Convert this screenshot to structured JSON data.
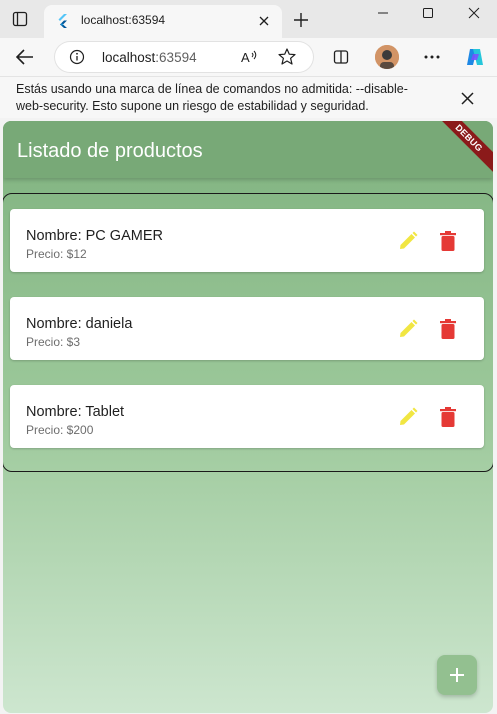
{
  "browser": {
    "tab": {
      "title": "localhost:63594"
    },
    "address": {
      "host": "localhost",
      "port": ":63594"
    },
    "infobar": {
      "message": "Estás usando una marca de línea de comandos no admitida: --disable-web-security. Esto supone un riesgo de estabilidad y seguridad."
    }
  },
  "app": {
    "title": "Listado de productos",
    "debug_banner": "DEBUG",
    "products": [
      {
        "name": "Nombre: PC GAMER",
        "price": "Precio: $12"
      },
      {
        "name": "Nombre: daniela",
        "price": "Precio: $3"
      },
      {
        "name": "Nombre: Tablet",
        "price": "Precio: $200"
      }
    ],
    "colors": {
      "appbar": "#78a977",
      "edit_icon": "#f1e642",
      "delete_icon": "#e53935",
      "fab": "#93c090"
    },
    "icons": {
      "edit": "pencil-icon",
      "delete": "trash-icon",
      "add": "plus-icon"
    }
  }
}
